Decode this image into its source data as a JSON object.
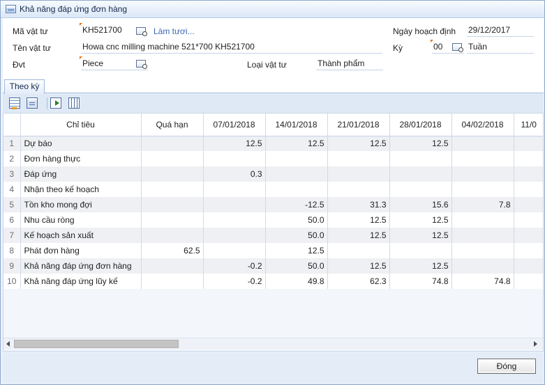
{
  "window": {
    "title": "Khả năng đáp ứng đơn hàng",
    "icon": "calculator-icon"
  },
  "form": {
    "item_code": {
      "label": "Mã vật tư",
      "value": "KH521700",
      "refresh_link": "Làm tươi..."
    },
    "item_name": {
      "label": "Tên vật tư",
      "value": "Howa cnc milling machine 521*700 KH521700"
    },
    "uom": {
      "label": "Đvt",
      "value": "Piece"
    },
    "item_type": {
      "label": "Loại vật tư",
      "value": "Thành phẩm"
    },
    "planning_date": {
      "label": "Ngày hoạch định",
      "value": "29/12/2017"
    },
    "period": {
      "label": "Kỳ",
      "value": "00",
      "unit": "Tuần"
    }
  },
  "tabs": [
    {
      "label": "Theo kỳ",
      "active": true
    }
  ],
  "toolbar": {
    "icons": [
      "grid-settings-icon",
      "document-icon",
      "export-icon",
      "columns-icon"
    ]
  },
  "grid": {
    "columns": [
      "",
      "Chỉ tiêu",
      "Quá hạn",
      "07/01/2018",
      "14/01/2018",
      "21/01/2018",
      "28/01/2018",
      "04/02/2018",
      "11/0"
    ],
    "rows": [
      [
        "1",
        "Dự báo",
        "",
        "12.5",
        "12.5",
        "12.5",
        "12.5",
        "",
        ""
      ],
      [
        "2",
        "Đơn hàng thực",
        "",
        "",
        "",
        "",
        "",
        "",
        ""
      ],
      [
        "3",
        "Đáp ứng",
        "",
        "0.3",
        "",
        "",
        "",
        "",
        ""
      ],
      [
        "4",
        "Nhận theo kế hoạch",
        "",
        "",
        "",
        "",
        "",
        "",
        ""
      ],
      [
        "5",
        "Tồn kho mong đợi",
        "",
        "",
        "-12.5",
        "31.3",
        "15.6",
        "7.8",
        ""
      ],
      [
        "6",
        "Nhu cầu ròng",
        "",
        "",
        "50.0",
        "12.5",
        "12.5",
        "",
        ""
      ],
      [
        "7",
        "Kế hoạch sản xuất",
        "",
        "",
        "50.0",
        "12.5",
        "12.5",
        "",
        ""
      ],
      [
        "8",
        "Phát đơn hàng",
        "62.5",
        "",
        "12.5",
        "",
        "",
        "",
        ""
      ],
      [
        "9",
        "Khả năng đáp ứng đơn hàng",
        "",
        "-0.2",
        "50.0",
        "12.5",
        "12.5",
        "",
        ""
      ],
      [
        "10",
        "Khả năng đáp ứng lũy kế",
        "",
        "-0.2",
        "49.8",
        "62.3",
        "74.8",
        "74.8",
        ""
      ]
    ]
  },
  "footer": {
    "close_label": "Đóng"
  }
}
